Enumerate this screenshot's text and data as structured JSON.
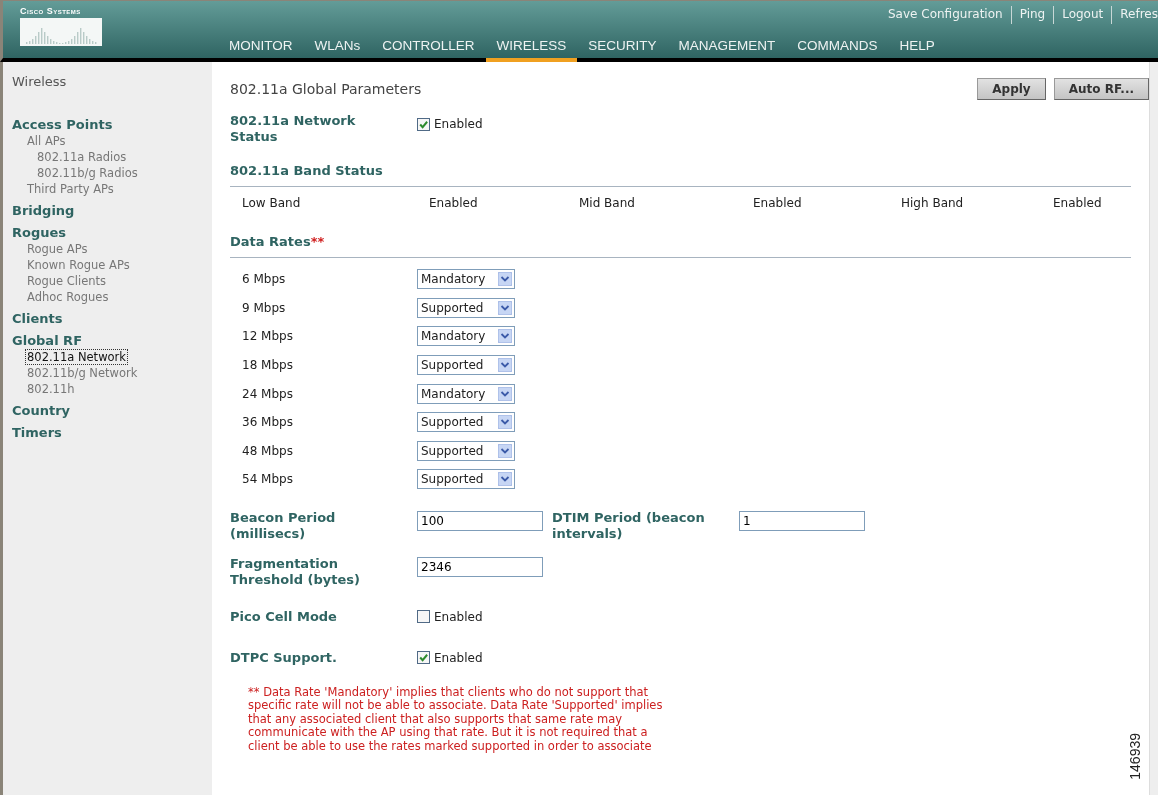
{
  "header": {
    "brand": "Cisco Systems",
    "links": [
      {
        "label": "Save Configuration"
      },
      {
        "label": "Ping"
      },
      {
        "label": "Logout"
      },
      {
        "label": "Refres"
      }
    ],
    "nav": [
      {
        "label": "MONITOR",
        "selected": false
      },
      {
        "label": "WLANs",
        "selected": false
      },
      {
        "label": "CONTROLLER",
        "selected": false
      },
      {
        "label": "WIRELESS",
        "selected": true
      },
      {
        "label": "SECURITY",
        "selected": false
      },
      {
        "label": "MANAGEMENT",
        "selected": false
      },
      {
        "label": "COMMANDS",
        "selected": false
      },
      {
        "label": "HELP",
        "selected": false
      }
    ]
  },
  "sidebar": {
    "title": "Wireless",
    "sections": [
      {
        "label": "Access Points",
        "children": [
          {
            "label": "All APs",
            "selected": false,
            "children": [
              {
                "label": "802.11a Radios",
                "selected": false
              },
              {
                "label": "802.11b/g Radios",
                "selected": false
              }
            ]
          },
          {
            "label": "Third Party APs",
            "selected": false
          }
        ]
      },
      {
        "label": "Bridging"
      },
      {
        "label": "Rogues",
        "children": [
          {
            "label": "Rogue APs",
            "selected": false
          },
          {
            "label": "Known Rogue APs",
            "selected": false
          },
          {
            "label": "Rogue Clients",
            "selected": false
          },
          {
            "label": "Adhoc Rogues",
            "selected": false
          }
        ]
      },
      {
        "label": "Clients"
      },
      {
        "label": "Global RF",
        "children": [
          {
            "label": "802.11a Network",
            "selected": true
          },
          {
            "label": "802.11b/g Network",
            "selected": false
          },
          {
            "label": "802.11h",
            "selected": false
          }
        ]
      },
      {
        "label": "Country"
      },
      {
        "label": "Timers"
      }
    ]
  },
  "main": {
    "title": "802.11a Global Parameters",
    "buttons": [
      "Apply",
      "Auto RF..."
    ],
    "network_status": {
      "label": "802.11a Network Status",
      "option": "Enabled",
      "checked": true
    },
    "band_status": {
      "heading": "802.11a Band Status",
      "items": [
        {
          "label": "Low Band",
          "value": "Enabled"
        },
        {
          "label": "Mid Band",
          "value": "Enabled"
        },
        {
          "label": "High Band",
          "value": "Enabled"
        }
      ]
    },
    "data_rates": {
      "heading": "Data Rates",
      "marker": "**",
      "rates": [
        {
          "label": "6 Mbps",
          "value": "Mandatory"
        },
        {
          "label": "9 Mbps",
          "value": "Supported"
        },
        {
          "label": "12 Mbps",
          "value": "Mandatory"
        },
        {
          "label": "18 Mbps",
          "value": "Supported"
        },
        {
          "label": "24 Mbps",
          "value": "Mandatory"
        },
        {
          "label": "36 Mbps",
          "value": "Supported"
        },
        {
          "label": "48 Mbps",
          "value": "Supported"
        },
        {
          "label": "54 Mbps",
          "value": "Supported"
        }
      ]
    },
    "beacon_period": {
      "label": "Beacon Period (millisecs)",
      "value": "100"
    },
    "dtim_period": {
      "label": "DTIM Period (beacon intervals)",
      "value": "1"
    },
    "fragmentation_threshold": {
      "label": "Fragmentation Threshold (bytes)",
      "value": "2346"
    },
    "pico_cell_mode": {
      "label": "Pico Cell Mode",
      "option": "Enabled",
      "checked": false
    },
    "dtpc_support": {
      "label": "DTPC Support.",
      "option": "Enabled",
      "checked": true
    },
    "note": "** Data Rate 'Mandatory' implies that clients who do not support that specific rate will not be able to associate. Data Rate 'Supported' implies that any associated client that also supports that same rate may communicate with the AP using that rate. But it is not required that a client be able to use the rates marked supported in order to associate"
  },
  "figure_id": "146939"
}
